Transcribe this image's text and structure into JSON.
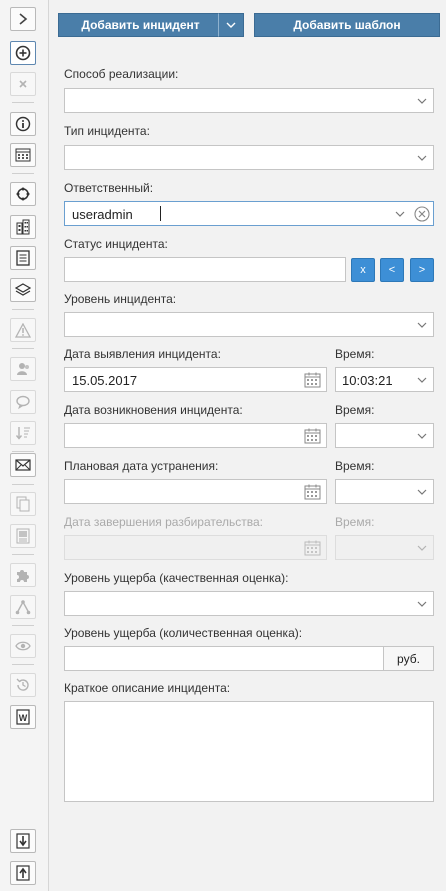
{
  "sidebar": {
    "icons": [
      "chevron-right-icon",
      "add-circle-icon",
      "close-icon",
      "info-icon",
      "calendar-grid-icon",
      "refresh-icon",
      "building-icon",
      "document-list-icon",
      "layers-icon",
      "warning-icon",
      "users-icon",
      "chat-icon",
      "sort-down-icon",
      "mail-icon",
      "copy-icon",
      "report-icon",
      "puzzle-icon",
      "tree-icon",
      "eye-icon",
      "history-icon",
      "word-icon",
      "download-icon",
      "upload-icon"
    ]
  },
  "toolbar": {
    "add_incident_label": "Добавить инцидент",
    "add_template_label": "Добавить шаблон"
  },
  "form": {
    "method_label": "Способ реализации:",
    "method_value": "",
    "type_label": "Тип инцидента:",
    "type_value": "",
    "responsible_label": "Ответственный:",
    "responsible_value": "useradmin",
    "status_label": "Статус инцидента:",
    "status_value": "",
    "status_clear_label": "x",
    "status_prev_label": "<",
    "status_next_label": ">",
    "level_label": "Уровень инцидента:",
    "level_value": "",
    "detect_date_label": "Дата выявления инцидента:",
    "detect_date_value": "15.05.2017",
    "detect_time_label": "Время:",
    "detect_time_value": "10:03:21",
    "occur_date_label": "Дата возникновения инцидента:",
    "occur_date_value": "",
    "occur_time_label": "Время:",
    "occur_time_value": "",
    "planned_date_label": "Плановая дата устранения:",
    "planned_date_value": "",
    "planned_time_label": "Время:",
    "planned_time_value": "",
    "finish_date_label": "Дата завершения разбирательства:",
    "finish_date_value": "",
    "finish_time_label": "Время:",
    "finish_time_value": "",
    "damage_quality_label": "Уровень ущерба (качественная оценка):",
    "damage_quality_value": "",
    "damage_quantity_label": "Уровень ущерба (количественная оценка):",
    "damage_quantity_value": "",
    "currency_label": "руб.",
    "description_label": "Краткое описание инцидента:",
    "description_value": ""
  },
  "colors": {
    "primary_button": "#4a7ea9",
    "nav_button": "#3d8fd6",
    "panel_bg": "#f2f2f2",
    "focus_border": "#6a9fd0"
  }
}
